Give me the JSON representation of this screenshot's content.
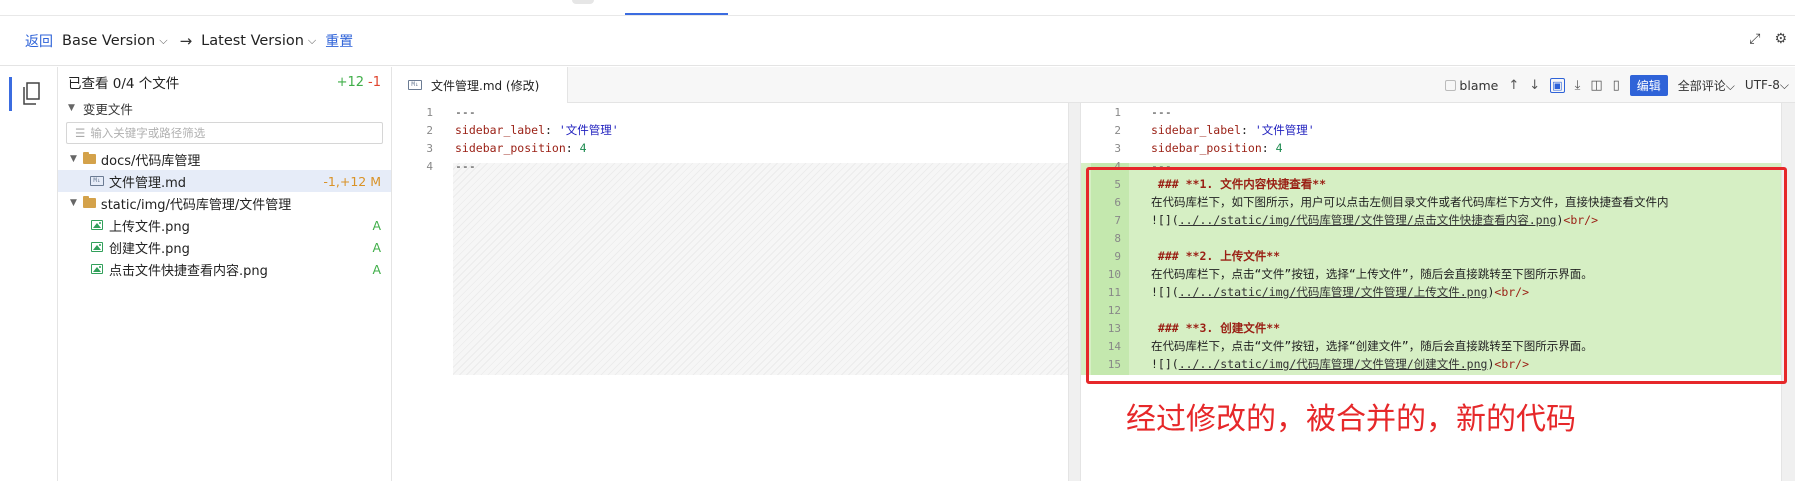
{
  "toolbar": {
    "back": "返回",
    "base_version": "Base Version",
    "target_version": "Latest Version",
    "reset": "重置"
  },
  "explorer": {
    "viewed": "已查看 0/4 个文件",
    "added": "+12",
    "removed": "-1",
    "section": "变更文件",
    "filter_placeholder": "输入关键字或路径筛选",
    "tree": [
      {
        "type": "folder",
        "name": "docs/代码库管理"
      },
      {
        "type": "md",
        "name": "文件管理.md",
        "badge": "-1,+12 M"
      },
      {
        "type": "folder",
        "name": "static/img/代码库管理/文件管理"
      },
      {
        "type": "image",
        "name": "上传文件.png",
        "badge": "A"
      },
      {
        "type": "image",
        "name": "创建文件.png",
        "badge": "A"
      },
      {
        "type": "image",
        "name": "点击文件快捷查看内容.png",
        "badge": "A"
      }
    ]
  },
  "editor": {
    "tab_title": "文件管理.md (修改)",
    "blame": "blame",
    "edit_button": "编辑",
    "comments": "全部评论",
    "encoding": "UTF-8"
  },
  "diff": {
    "left": [
      {
        "n": "1",
        "text": "---"
      },
      {
        "n": "2",
        "key": "sidebar_label",
        "str": "'文件管理'"
      },
      {
        "n": "3",
        "key": "sidebar_position",
        "num": "4"
      },
      {
        "n": "4",
        "text": "---"
      }
    ],
    "right": [
      {
        "n": "1",
        "text": "---"
      },
      {
        "n": "2",
        "key": "sidebar_label",
        "str": "'文件管理'"
      },
      {
        "n": "3",
        "key": "sidebar_position",
        "num": "4"
      },
      {
        "n": "4",
        "text": "---"
      },
      {
        "n": "5",
        "heading": " ### **1. 文件内容快捷查看**"
      },
      {
        "n": "6",
        "text": "在代码库栏下，如下图所示，用户可以点击左侧目录文件或者代码库栏下方文件，直接快捷查看文件内"
      },
      {
        "n": "7",
        "link": "../../static/img/代码库管理/文件管理/点击文件快捷查看内容.png"
      },
      {
        "n": "8",
        "text": ""
      },
      {
        "n": "9",
        "heading": " ### **2. 上传文件**"
      },
      {
        "n": "10",
        "text": "在代码库栏下，点击“文件”按钮，选择“上传文件”，随后会直接跳转至下图所示界面。"
      },
      {
        "n": "11",
        "link": "../../static/img/代码库管理/文件管理/上传文件.png"
      },
      {
        "n": "12",
        "text": ""
      },
      {
        "n": "13",
        "heading": " ### **3. 创建文件**"
      },
      {
        "n": "14",
        "text": "在代码库栏下，点击“文件”按钮，选择“创建文件”，随后会直接跳转至下图所示界面。"
      },
      {
        "n": "15",
        "link": "../../static/img/代码库管理/文件管理/创建文件.png"
      }
    ]
  },
  "annotation": "经过修改的，被合并的，新的代码",
  "colors": {
    "accent": "#2f63d8",
    "added_bg": "#d6efc4",
    "annotation_red": "#e6282a",
    "modified": "#d99226",
    "added": "#3fae48"
  }
}
